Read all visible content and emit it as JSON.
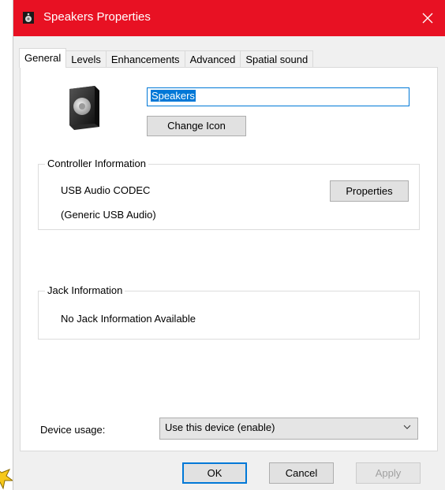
{
  "window": {
    "title": "Speakers Properties"
  },
  "tabs": [
    {
      "label": "General",
      "active": true
    },
    {
      "label": "Levels"
    },
    {
      "label": "Enhancements"
    },
    {
      "label": "Advanced"
    },
    {
      "label": "Spatial sound"
    }
  ],
  "general": {
    "device_name": "Speakers",
    "change_icon_label": "Change Icon",
    "controller": {
      "title": "Controller Information",
      "name": "USB Audio CODEC",
      "sub": "(Generic USB Audio)",
      "properties_label": "Properties"
    },
    "jack": {
      "title": "Jack Information",
      "text": "No Jack Information Available"
    },
    "device_usage": {
      "label": "Device usage:",
      "value": "Use this device (enable)"
    }
  },
  "footer": {
    "ok": "OK",
    "cancel": "Cancel",
    "apply": "Apply"
  },
  "colors": {
    "titlebar": "#e81123",
    "accent": "#0078d7",
    "disabled_text": "#a0a0a0"
  },
  "icons": [
    "speaker-app-icon",
    "close-icon",
    "speaker-device-icon",
    "chevron-down-icon",
    "decorative-star-icon"
  ]
}
